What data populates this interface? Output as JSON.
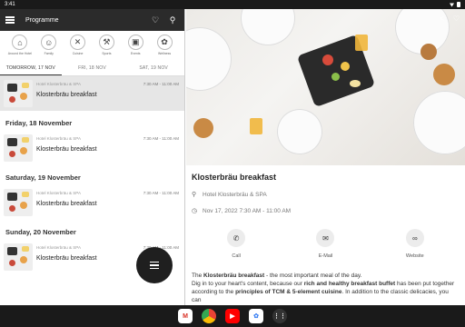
{
  "status": {
    "time": "3:41"
  },
  "appbar": {
    "title": "Programme"
  },
  "categories": [
    {
      "label": "Around the Hotel",
      "icon": "hotel-icon",
      "glyph": "⌂"
    },
    {
      "label": "Family",
      "icon": "stroller-icon",
      "glyph": "☺"
    },
    {
      "label": "Cuisine",
      "icon": "cutlery-icon",
      "glyph": "✕"
    },
    {
      "label": "Sports",
      "icon": "sports-icon",
      "glyph": "⚒"
    },
    {
      "label": "Events",
      "icon": "ticket-icon",
      "glyph": "▣"
    },
    {
      "label": "Wellness",
      "icon": "wellness-icon",
      "glyph": "✿"
    }
  ],
  "tabs": [
    "TOMORROW, 17 NOV",
    "FRI, 18 NOV",
    "SAT, 19 NOV"
  ],
  "list": {
    "items": [
      {
        "location": "Hotel Klosterbräu & SPA",
        "title": "Klosterbräu breakfast",
        "time": "7:30 AM - 11:00 AM"
      },
      {
        "location": "Hotel Klosterbräu & SPA",
        "title": "Klosterbräu breakfast",
        "time": "7:30 AM - 11:00 AM"
      },
      {
        "location": "Hotel Klosterbräu & SPA",
        "title": "Klosterbräu breakfast",
        "time": "7:30 AM - 11:00 AM"
      },
      {
        "location": "Hotel Klosterbräu & SPA",
        "title": "Klosterbräu breakfast",
        "time": "7:30 AM - 11:00 AM"
      }
    ],
    "days": [
      "Friday, 18 November",
      "Saturday, 19 November",
      "Sunday, 20 November"
    ]
  },
  "detail": {
    "title": "Klosterbräu breakfast",
    "location": "Hotel Klosterbräu & SPA",
    "datetime": "Nov 17, 2022 7:30 AM - 11:00 AM",
    "actions": [
      "Call",
      "E-Mail",
      "Website"
    ],
    "desc": {
      "p1_a": "The ",
      "p1_b": "Klosterbräu breakfast",
      "p1_c": " - the most important meal of the day.",
      "p2_a": "Dig in to your heart's content, because our ",
      "p2_b": "rich and healthy breakfast buffet",
      "p2_c": " has been put together according to the ",
      "p2_d": "principles of TCM & 5-element cuisine",
      "p2_e": ". In addition to the classic delicacies, you can"
    }
  },
  "colors": {
    "appbar": "#2b2b2b",
    "selected_row": "#e6e6e6",
    "fab": "#1f1f1f"
  }
}
